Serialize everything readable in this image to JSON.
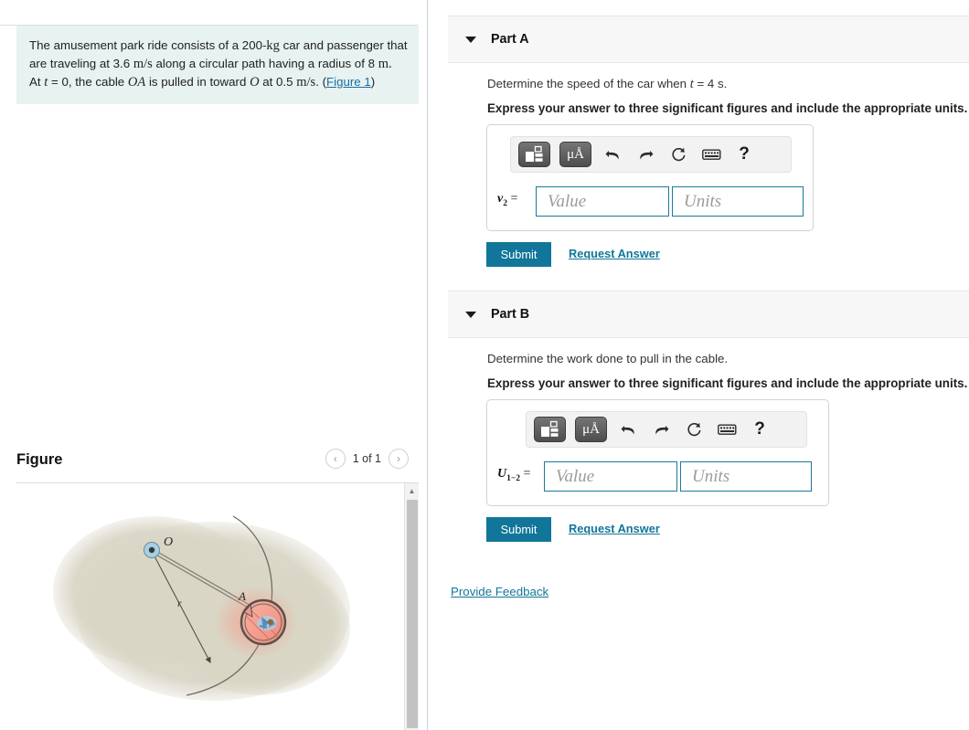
{
  "problem": {
    "line1_a": "The amusement park ride consists of a 200-",
    "line1_kg": "kg",
    "line1_b": " car and passenger that",
    "line2_a": "are traveling at 3.6 ",
    "line2_ms": "m/s",
    "line2_b": " along a circular path having a radius of 8 ",
    "line2_m": "m.",
    "line3_a": "At ",
    "line3_t": "t",
    "line3_b": " = 0, the cable ",
    "line3_oa": "OA",
    "line3_c": " is pulled in toward ",
    "line3_o": "O",
    "line3_d": " at 0.5 ",
    "line3_ms": "m/s",
    "line3_e": ". (",
    "figure_link": "Figure 1",
    "line3_f": ")"
  },
  "figure": {
    "title": "Figure",
    "counter": "1 of 1",
    "prev_icon": "chevron-left-icon",
    "next_icon": "chevron-right-icon",
    "prev_glyph": "‹",
    "next_glyph": "›",
    "scroll_up_glyph": "▲",
    "labels": {
      "point_o": "O",
      "point_a": "A",
      "radius": "r"
    },
    "colors": {
      "blob": "#d9d6c6",
      "car_fill": "#f6a99b",
      "car_ring": "#6b655e",
      "pivot_fill": "#a8cfe3",
      "line": "#7d7970",
      "passenger": "#4f8fbf"
    }
  },
  "toolbar": {
    "template_button": "math-template-button",
    "units_button": "μÅ",
    "undo_glyph": "↶",
    "redo_glyph": "↷",
    "reset_glyph": "↻",
    "keyboard_glyph": "⌨",
    "help_glyph": "?"
  },
  "parts": [
    {
      "id": "part-a",
      "label": "Part A",
      "question_pre": "Determine the speed of the car when ",
      "question_var": "t",
      "question_post": " = 4 s.",
      "instruction": "Express your answer to three significant figures and include the appropriate units.",
      "answer_label_base": "v",
      "answer_label_sub": "2",
      "answer_label_eq": " =",
      "value_placeholder": "Value",
      "units_placeholder": "Units",
      "value_current": "",
      "units_current": "",
      "submit_label": "Submit",
      "request_label": "Request Answer"
    },
    {
      "id": "part-b",
      "label": "Part B",
      "question_pre": "Determine the work done to pull in the cable.",
      "question_var": "",
      "question_post": "",
      "instruction": "Express your answer to three significant figures and include the appropriate units.",
      "answer_label_base": "U",
      "answer_label_sub": "1−2",
      "answer_label_eq": " =",
      "value_placeholder": "Value",
      "units_placeholder": "Units",
      "value_current": "",
      "units_current": "",
      "submit_label": "Submit",
      "request_label": "Request Answer"
    }
  ],
  "footer": {
    "feedback_label": "Provide Feedback"
  },
  "colors": {
    "accent": "#11769a",
    "problem_bg": "#e7f2f1",
    "part_header_bg": "#f7f7f7",
    "input_border": "#1b7b94"
  }
}
